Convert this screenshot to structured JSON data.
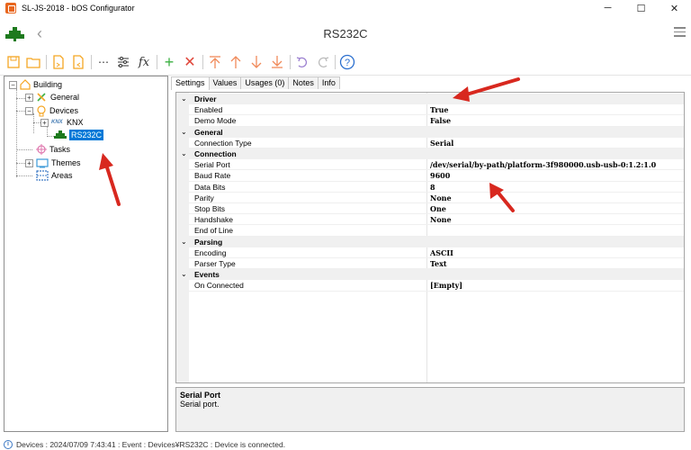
{
  "window": {
    "title": "SL-JS-2018 - bOS Configurator",
    "minimize": "─",
    "maximize": "☐",
    "close": "✕"
  },
  "header": {
    "title": "RS232C",
    "back": "‹"
  },
  "tree": {
    "root": "Building",
    "general": "General",
    "devices": "Devices",
    "knx": "KNX",
    "knx_logo": "KNX",
    "rs232c": "RS232C",
    "tasks": "Tasks",
    "themes": "Themes",
    "areas": "Areas",
    "expand_minus": "−",
    "expand_plus": "+"
  },
  "tabs": [
    "Settings",
    "Values",
    "Usages (0)",
    "Notes",
    "Info"
  ],
  "grid": {
    "driver": "Driver",
    "enabled": "Enabled",
    "enabled_val": "True",
    "demo": "Demo Mode",
    "demo_val": "False",
    "general": "General",
    "conn_type": "Connection Type",
    "conn_type_val": "Serial",
    "connection": "Connection",
    "serial_port": "Serial Port",
    "serial_port_val": "/dev/serial/by-path/platform-3f980000.usb-usb-0:1.2:1.0",
    "baud": "Baud Rate",
    "baud_val": "9600",
    "data_bits": "Data Bits",
    "data_bits_val": "8",
    "parity": "Parity",
    "parity_val": "None",
    "stop_bits": "Stop Bits",
    "stop_bits_val": "One",
    "handshake": "Handshake",
    "handshake_val": "None",
    "eol": "End of Line",
    "eol_val": "",
    "parsing": "Parsing",
    "encoding": "Encoding",
    "encoding_val": "ASCII",
    "parser_type": "Parser Type",
    "parser_type_val": "Text",
    "events": "Events",
    "on_connected": "On Connected",
    "on_connected_val": "[Empty]",
    "chev": "⌄"
  },
  "description": {
    "title": "Serial Port",
    "text": "Serial port."
  },
  "status": {
    "icon": "i",
    "text": "Devices : 2024/07/09 7:43:41 : Event : Devices¥RS232C : Device is connected."
  },
  "colors": {
    "accent": "#0078d7",
    "toolbar_orange": "#f5a623",
    "toolbar_green": "#3cb043",
    "toolbar_red": "#e0463a",
    "arrow_red": "#d8281f",
    "tree_green": "#1e7a1e"
  }
}
